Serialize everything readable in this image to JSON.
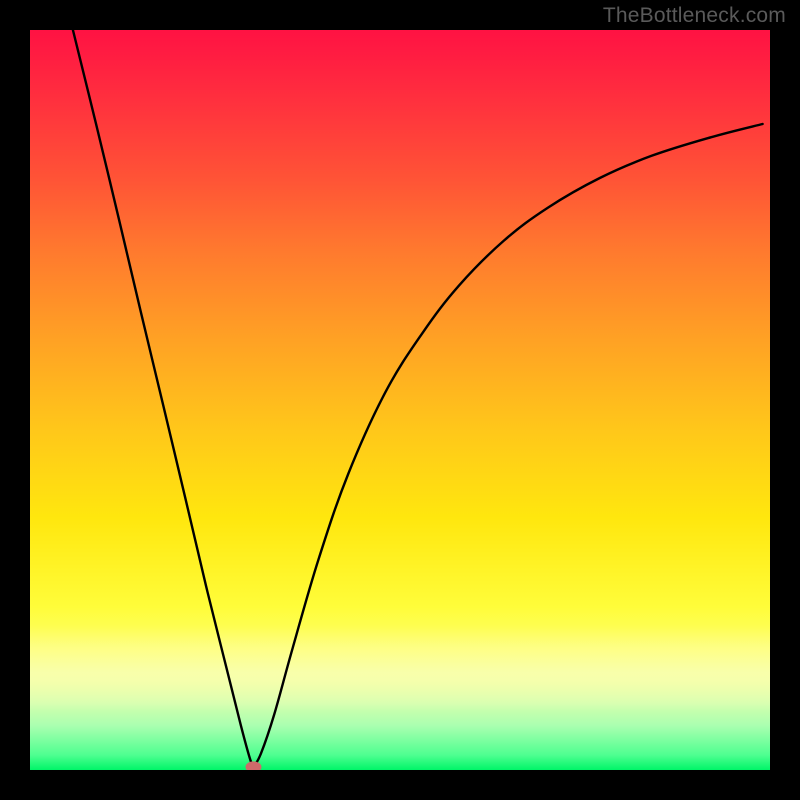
{
  "watermark": "TheBottleneck.com",
  "chart_data": {
    "type": "line",
    "title": "",
    "xlabel": "",
    "ylabel": "",
    "xlim": [
      0,
      1
    ],
    "ylim": [
      0,
      1
    ],
    "annotations": [
      {
        "name": "minimum-marker",
        "x": 0.302,
        "y": 0.004,
        "color": "#cd6a6a"
      }
    ],
    "series": [
      {
        "name": "left-branch",
        "x": [
          0.058,
          0.09,
          0.12,
          0.15,
          0.18,
          0.21,
          0.24,
          0.265,
          0.285,
          0.297,
          0.302
        ],
        "values": [
          1.0,
          0.87,
          0.745,
          0.618,
          0.493,
          0.367,
          0.24,
          0.14,
          0.06,
          0.016,
          0.004
        ]
      },
      {
        "name": "right-branch",
        "x": [
          0.302,
          0.312,
          0.33,
          0.355,
          0.39,
          0.43,
          0.48,
          0.53,
          0.58,
          0.64,
          0.7,
          0.77,
          0.84,
          0.92,
          0.99
        ],
        "values": [
          0.004,
          0.022,
          0.075,
          0.165,
          0.285,
          0.4,
          0.51,
          0.59,
          0.655,
          0.715,
          0.76,
          0.8,
          0.83,
          0.855,
          0.873
        ]
      }
    ],
    "background_gradient": {
      "stops": [
        {
          "pos": 0.0,
          "color": "#ff1243"
        },
        {
          "pos": 0.3,
          "color": "#ff7a2e"
        },
        {
          "pos": 0.6,
          "color": "#ffd315"
        },
        {
          "pos": 0.82,
          "color": "#fffd50"
        },
        {
          "pos": 0.94,
          "color": "#aaffb0"
        },
        {
          "pos": 1.0,
          "color": "#00f568"
        }
      ]
    }
  }
}
